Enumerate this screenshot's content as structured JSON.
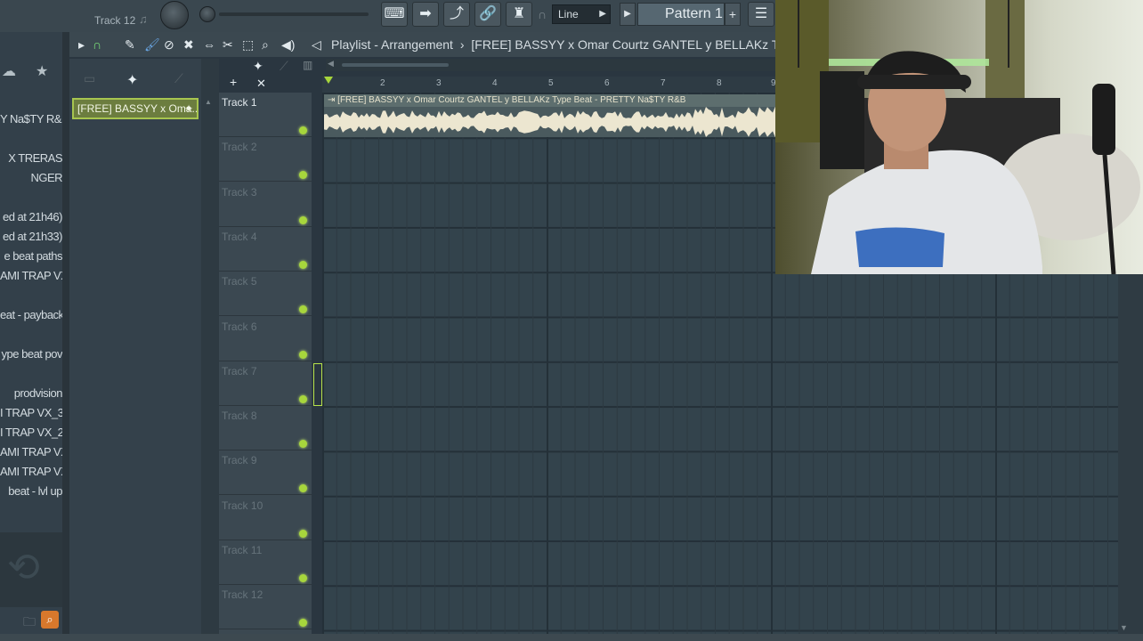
{
  "toolbar": {
    "track_label": "Track 12",
    "snap_mode": "Line",
    "pattern_label": "Pattern 1",
    "add_symbol": "+"
  },
  "playlist": {
    "title": "Playlist - Arrangement",
    "arrow": "›",
    "song_name": "[FREE] BASSYY x Omar Courtz GANTEL y BELLAKz Type Beat - PRETTY Na$TY R&B",
    "picker_item": "[FREE] BASSYY x Oma..."
  },
  "browser": {
    "items": [
      "Y Na$TY  R&B",
      "X TRERAS",
      "NGER",
      "ed at 21h46)",
      "ed at 21h33)",
      "e beat paths",
      "AMI TRAP VX",
      "eat - payback",
      "ype beat pov",
      "prodvision",
      "I TRAP VX_3",
      "I TRAP VX_2",
      "AMI TRAP VX",
      "AMI TRAP VX",
      "beat - lvl up"
    ]
  },
  "ruler": {
    "bars": [
      "2",
      "3",
      "4",
      "5",
      "6",
      "7",
      "8",
      "9"
    ]
  },
  "tracks": [
    "Track 1",
    "Track 2",
    "Track 3",
    "Track 4",
    "Track 5",
    "Track 6",
    "Track 7",
    "Track 8",
    "Track 9",
    "Track 10",
    "Track 11",
    "Track 12"
  ],
  "colors": {
    "accent_green": "#a7d63c",
    "grid_bg": "#33434c",
    "selected_clip": "#6c7d3f"
  }
}
